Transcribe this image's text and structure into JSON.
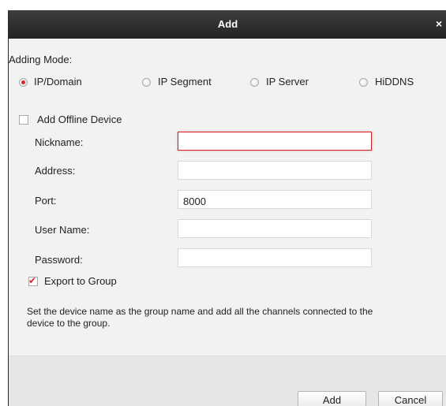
{
  "dialog": {
    "title": "Add",
    "close_glyph": "×"
  },
  "adding_mode": {
    "label": "Adding Mode:",
    "options": [
      "IP/Domain",
      "IP Segment",
      "IP Server",
      "HiDDNS"
    ],
    "selected": "IP/Domain"
  },
  "offline_device": {
    "label": "Add Offline Device",
    "checked": false
  },
  "fields": {
    "nickname": {
      "label": "Nickname:",
      "value": ""
    },
    "address": {
      "label": "Address:",
      "value": ""
    },
    "port": {
      "label": "Port:",
      "value": "8000"
    },
    "user_name": {
      "label": "User Name:",
      "value": ""
    },
    "password": {
      "label": "Password:",
      "value": ""
    }
  },
  "export_group": {
    "label": "Export to Group",
    "checked": true,
    "description": "Set the device name as the group name and add all the channels connected to the device to the group."
  },
  "buttons": {
    "add": "Add",
    "cancel": "Cancel"
  },
  "colors": {
    "accent": "#d5252b",
    "titlebar": "#2b2b2b",
    "panel": "#f2f2f2",
    "footer": "#e6e6e6"
  },
  "icons": {
    "close": "close-icon",
    "checkmark": "checkmark-icon"
  }
}
